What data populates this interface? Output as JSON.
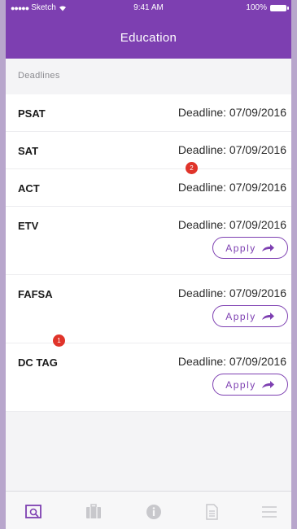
{
  "status_bar": {
    "carrier": "Sketch",
    "time": "9:41 AM",
    "battery": "100%"
  },
  "header": {
    "title": "Education"
  },
  "section": {
    "title": "Deadlines"
  },
  "deadlines": [
    {
      "name": "PSAT",
      "deadline": "Deadline: 07/09/2016"
    },
    {
      "name": "SAT",
      "deadline": "Deadline: 07/09/2016"
    },
    {
      "name": "ACT",
      "deadline": "Deadline: 07/09/2016"
    },
    {
      "name": "ETV",
      "deadline": "Deadline: 07/09/2016",
      "action": "Apply"
    },
    {
      "name": "FAFSA",
      "deadline": "Deadline: 07/09/2016",
      "action": "Apply"
    },
    {
      "name": "DC TAG",
      "deadline": "Deadline: 07/09/2016",
      "action": "Apply"
    }
  ],
  "badges": {
    "act_badge": "2",
    "fafsa_badge": "1"
  },
  "tabs": [
    {
      "icon": "search-profile-icon",
      "active": true
    },
    {
      "icon": "briefcase-icon",
      "active": false
    },
    {
      "icon": "info-icon",
      "active": false
    },
    {
      "icon": "document-icon",
      "active": false
    },
    {
      "icon": "menu-icon",
      "active": false
    }
  ],
  "colors": {
    "brand": "#7d3fb1",
    "badge": "#e0342a",
    "inactive_tab": "#c8c8cc"
  }
}
